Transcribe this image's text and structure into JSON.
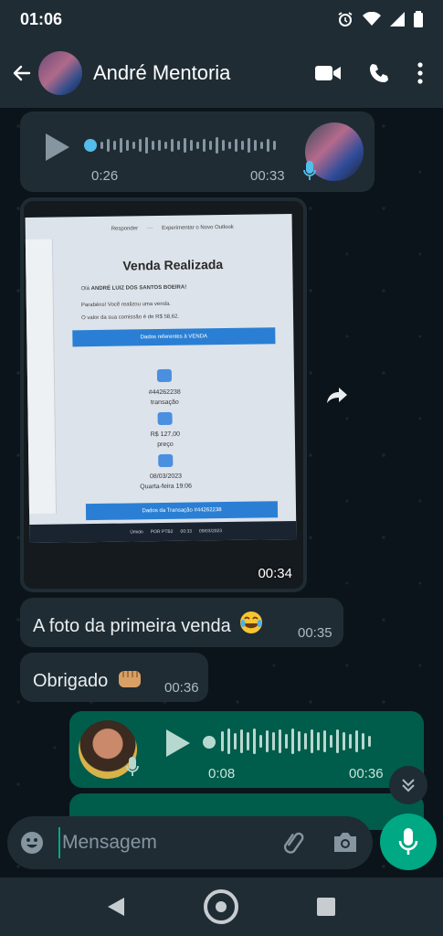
{
  "status_bar": {
    "time": "01:06",
    "icons": [
      "alarm-icon",
      "wifi-icon",
      "signal-icon",
      "battery-icon"
    ]
  },
  "header": {
    "contact_name": "André Mentoria",
    "actions": [
      "video-call-icon",
      "voice-call-icon",
      "more-options-icon"
    ]
  },
  "colors": {
    "header_bg": "#1f2c34",
    "incoming_bubble": "#1f2c34",
    "outgoing_bubble": "#005c4b",
    "accent": "#00a884",
    "chat_bg": "#0b141a"
  },
  "messages": [
    {
      "type": "voice",
      "direction": "in",
      "duration": "0:26",
      "time": "00:33"
    },
    {
      "type": "image",
      "direction": "in",
      "time": "00:34",
      "photo": {
        "reply": "Responder",
        "more": "···",
        "toggle": "Experimentar o Novo Outlook",
        "heading": "Venda Realizada",
        "greeting_prefix": "Olá",
        "greeting_name": "ANDRÉ LUIZ DOS SANTOS BOEIRA!",
        "congrats": "Parabéns! Você realizou uma venda.",
        "commission": "O valor da sua comissão é de R$ 58,62.",
        "band1": "Dados referentes à VENDA",
        "transaction_id": "#44262238",
        "transaction_label": "transação",
        "price": "R$ 127,00",
        "price_label": "preço",
        "date": "08/03/2023",
        "date_label": "Quarta-feira 19:06",
        "band2": "Dados da Transação #44262238",
        "taskbar_weather": "Úmido",
        "taskbar_lang": "POR PTB2",
        "taskbar_time": "00:33",
        "taskbar_date": "09/03/2023"
      }
    },
    {
      "type": "text",
      "direction": "in",
      "text": "A foto da primeira venda",
      "emoji": "joy-emoji",
      "time": "00:35"
    },
    {
      "type": "text",
      "direction": "in",
      "text": "Obrigado",
      "emoji": "fist-emoji",
      "time": "00:36"
    },
    {
      "type": "voice",
      "direction": "out",
      "duration": "0:08",
      "time": "00:36"
    }
  ],
  "composer": {
    "placeholder": "Mensagem"
  }
}
